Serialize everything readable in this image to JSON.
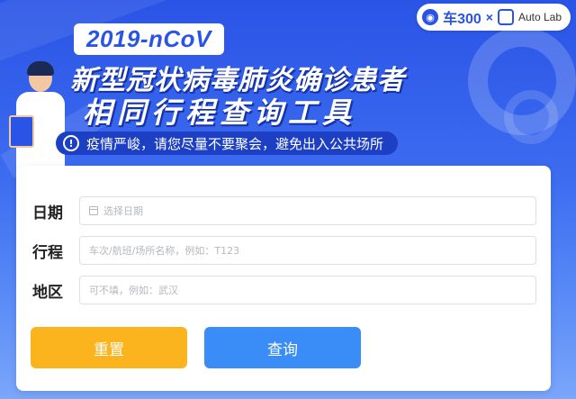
{
  "brand": {
    "name": "车300",
    "separator": "×",
    "partner": "Auto Lab"
  },
  "banner": {
    "tag": "2019-nCoV",
    "title_line1": "新型冠状病毒肺炎确诊患者",
    "title_line2": "相同行程查询工具",
    "notice": "疫情严峻，请您尽量不要聚会，避免出入公共场所"
  },
  "form": {
    "date": {
      "label": "日期",
      "placeholder": "选择日期"
    },
    "trip": {
      "label": "行程",
      "placeholder": "车次/航班/场所名称，例如：T123"
    },
    "region": {
      "label": "地区",
      "placeholder": "可不填，例如：武汉"
    }
  },
  "buttons": {
    "reset": "重置",
    "query": "查询"
  },
  "colors": {
    "primary_blue": "#2a54e6",
    "reset_yellow": "#fbb31e",
    "query_blue": "#3a8cf7"
  }
}
